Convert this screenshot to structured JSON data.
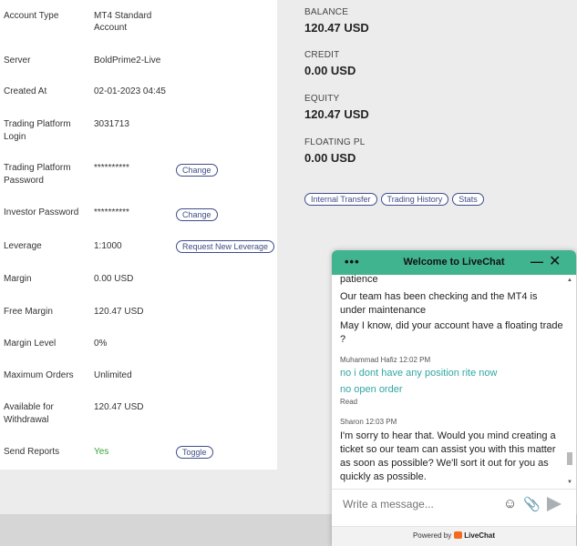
{
  "account": {
    "rows": [
      {
        "label": "Account Type",
        "value": "MT4 Standard Account"
      },
      {
        "label": "Server",
        "value": "BoldPrime2-Live"
      },
      {
        "label": "Created At",
        "value": "02-01-2023 04:45"
      },
      {
        "label": "Trading Platform Login",
        "value": "3031713"
      },
      {
        "label": "Trading Platform Password",
        "value": "**********",
        "action": "Change"
      },
      {
        "label": "Investor Password",
        "value": "**********",
        "action": "Change"
      },
      {
        "label": "Leverage",
        "value": "1:1000",
        "action": "Request New Leverage"
      },
      {
        "label": "Margin",
        "value": "0.00 USD"
      },
      {
        "label": "Free Margin",
        "value": "120.47 USD"
      },
      {
        "label": "Margin Level",
        "value": "0%"
      },
      {
        "label": "Maximum Orders",
        "value": "Unlimited"
      },
      {
        "label": "Available for Withdrawal",
        "value": "120.47 USD"
      },
      {
        "label": "Send Reports",
        "value": "Yes",
        "action": "Toggle"
      }
    ]
  },
  "summary": {
    "balance_label": "BALANCE",
    "balance_value": "120.47 USD",
    "credit_label": "CREDIT",
    "credit_value": "0.00 USD",
    "equity_label": "EQUITY",
    "equity_value": "120.47 USD",
    "floating_label": "FLOATING PL",
    "floating_value": "0.00 USD",
    "buttons": [
      "Internal Transfer",
      "Trading History",
      "Stats"
    ]
  },
  "chat": {
    "header_title": "Welcome to LiveChat",
    "menu_glyph": "•••",
    "messages": {
      "m1": "patience",
      "m2": "Our team has been checking and the MT4 is under maintenance",
      "m3": "May I know, did your account have a floating trade ?",
      "meta1": "Muhammad Hafiz 12:02 PM",
      "m4": "no i dont have any position rite now",
      "m5": "no open order",
      "read": "Read",
      "meta2": "Sharon 12:03 PM",
      "m6": "I'm sorry to hear that. Would you mind creating a ticket so our team can assist you with this matter as soon as possible? We'll sort it out for you as quickly as possible."
    },
    "input_placeholder": "Write a message...",
    "footer_prefix": "Powered by",
    "footer_brand": "LiveChat"
  },
  "colors": {
    "chat_header": "#3fb48f",
    "pill_border": "#3f4d8a",
    "sent_message": "#2fa7a2",
    "yes_green": "#3aa23a"
  }
}
